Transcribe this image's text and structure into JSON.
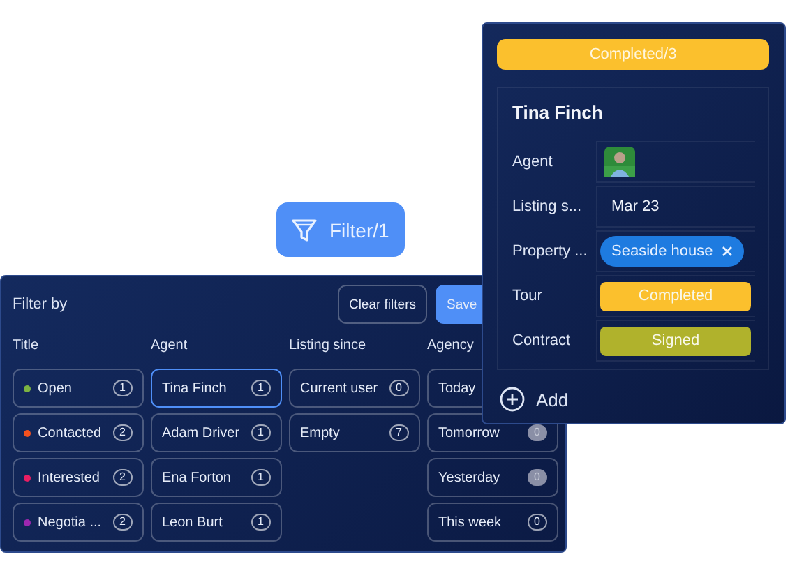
{
  "filter_button": {
    "label": "Filter/1"
  },
  "filter_panel": {
    "title": "Filter by",
    "buttons": [
      {
        "label": "Clear filters",
        "kind": "outline"
      },
      {
        "label": "Save",
        "kind": "primary"
      }
    ],
    "columns": [
      {
        "heading": "Title",
        "items": [
          {
            "label": "Open",
            "count": "1",
            "color": "#7cb342",
            "selected": false
          },
          {
            "label": "Contacted",
            "count": "2",
            "color": "#f4511e",
            "selected": false
          },
          {
            "label": "Interested",
            "count": "2",
            "color": "#e91e63",
            "selected": false
          },
          {
            "label": "Negotia ...",
            "count": "2",
            "color": "#9c27b0",
            "selected": false
          }
        ]
      },
      {
        "heading": "Agent",
        "items": [
          {
            "label": "Tina Finch",
            "count": "1",
            "selected": true
          },
          {
            "label": "Adam Driver",
            "count": "1",
            "selected": false
          },
          {
            "label": "Ena Forton",
            "count": "1",
            "selected": false
          },
          {
            "label": "Leon Burt",
            "count": "1",
            "selected": false
          }
        ]
      },
      {
        "heading": "Listing since",
        "items": [
          {
            "label": "Current user",
            "count": "0",
            "selected": false
          },
          {
            "label": "Empty",
            "count": "7",
            "selected": false
          }
        ]
      },
      {
        "heading": "Agency",
        "items": [
          {
            "label": "Today",
            "selected": false
          },
          {
            "label": "Tomorrow",
            "count": "0",
            "disabled": true,
            "selected": false
          },
          {
            "label": "Yesterday",
            "count": "0",
            "disabled": true,
            "selected": false
          },
          {
            "label": "This week",
            "count": "0",
            "disabled": false,
            "selected": false
          }
        ]
      }
    ]
  },
  "card": {
    "group_badge": "Completed/3",
    "title": "Tina Finch",
    "fields": [
      {
        "label": "Agent",
        "kind": "avatar"
      },
      {
        "label": "Listing s...",
        "kind": "text",
        "value": "Mar 23"
      },
      {
        "label": "Property ...",
        "kind": "tag",
        "value": "Seaside house"
      },
      {
        "label": "Tour",
        "kind": "status",
        "value": "Completed",
        "color": "#fbc02d"
      },
      {
        "label": "Contract",
        "kind": "status",
        "value": "Signed",
        "color": "#b0b22c"
      }
    ],
    "add_label": "Add"
  }
}
